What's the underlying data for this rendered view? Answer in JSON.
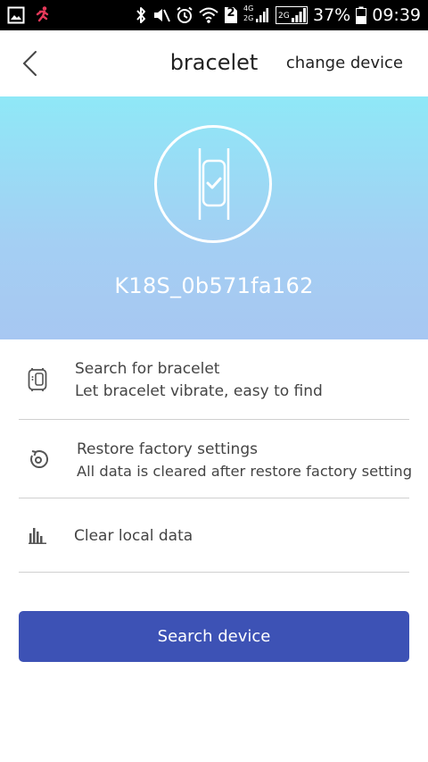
{
  "status_bar": {
    "battery_percent": "37%",
    "time": "09:39",
    "sim_slot": "2",
    "net1": "4G",
    "net2": "2G",
    "net3": "2G",
    "icons": [
      "gallery-icon",
      "runner-icon",
      "bluetooth-icon",
      "mute-icon",
      "alarm-icon",
      "wifi-icon",
      "sim-icon",
      "signal-icon",
      "battery-icon"
    ]
  },
  "header": {
    "title": "bracelet",
    "change_device": "change device"
  },
  "device": {
    "name": "K18S_0b571fa162"
  },
  "menu": {
    "items": [
      {
        "title": "Search for bracelet",
        "subtitle": "Let bracelet vibrate, easy to find",
        "icon": "bracelet-search-icon"
      },
      {
        "title": "Restore factory settings",
        "subtitle": "All data is cleared after restore factory setting",
        "icon": "restore-icon"
      },
      {
        "title": "Clear local data",
        "icon": "chart-bars-icon"
      }
    ]
  },
  "button": {
    "search_device": "Search device"
  },
  "colors": {
    "accent": "#3d52b5",
    "hero_top": "#8fe8f7",
    "hero_bottom": "#a7c7f2",
    "runner": "#e5395a"
  }
}
